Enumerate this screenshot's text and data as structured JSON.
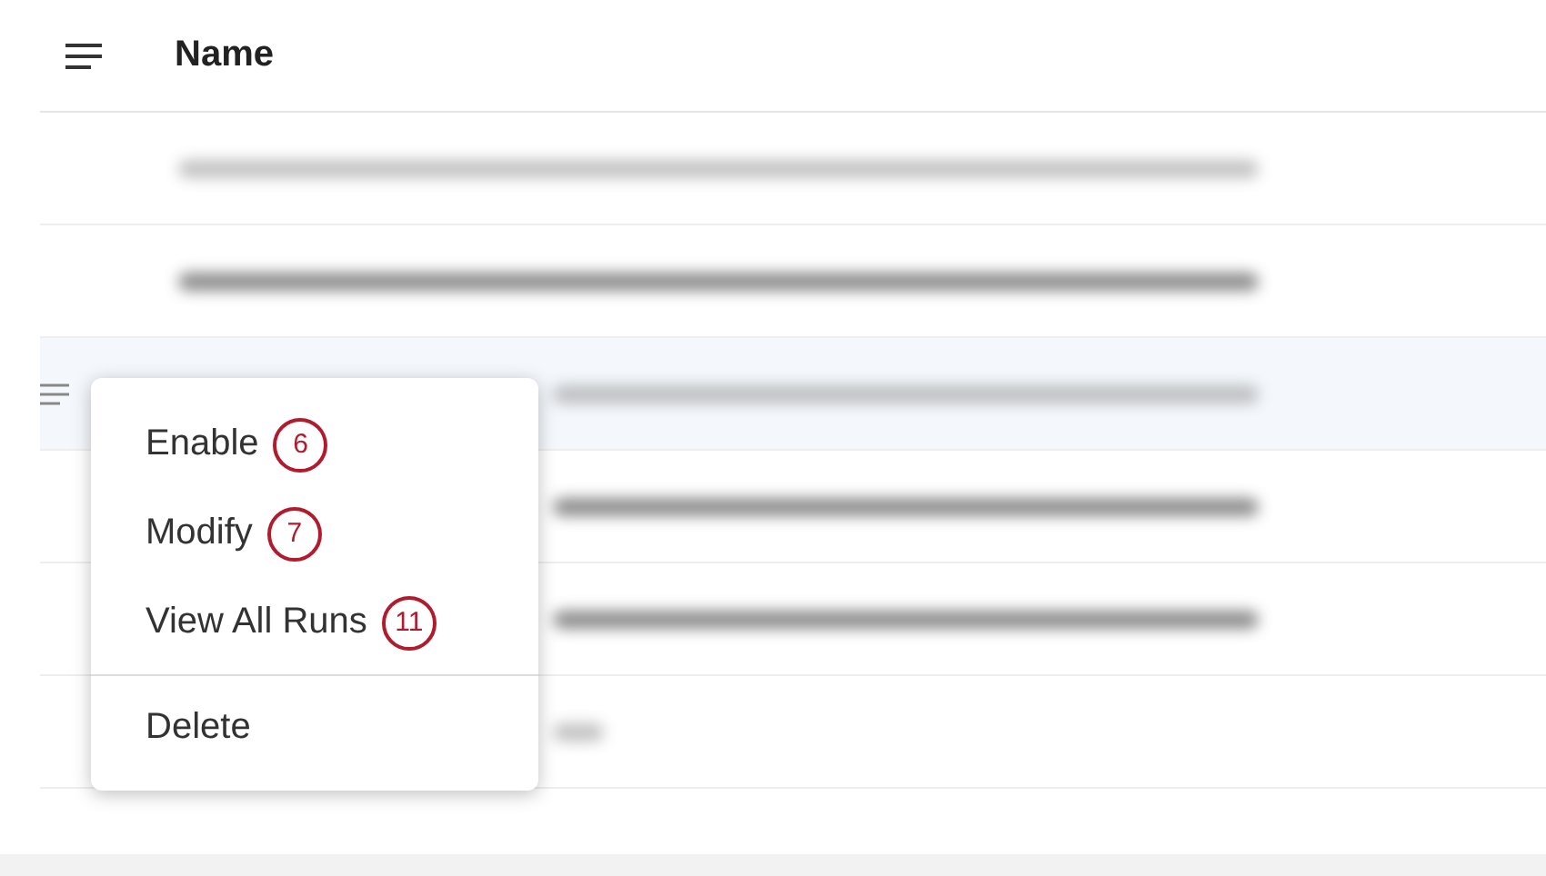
{
  "table": {
    "columns": [
      {
        "label": "Name"
      }
    ],
    "rows": [
      {
        "selected": false,
        "faded": true,
        "kind": "long"
      },
      {
        "selected": false,
        "faded": false,
        "kind": "long"
      },
      {
        "selected": true,
        "faded": true,
        "kind": "long"
      },
      {
        "selected": false,
        "faded": false,
        "kind": "long"
      },
      {
        "selected": false,
        "faded": false,
        "kind": "long"
      },
      {
        "selected": false,
        "faded": true,
        "kind": "short"
      }
    ]
  },
  "context_menu": {
    "items": [
      {
        "label": "Enable",
        "badge": "6",
        "divider_before": false
      },
      {
        "label": "Modify",
        "badge": "7",
        "divider_before": false
      },
      {
        "label": "View All Runs",
        "badge": "11",
        "divider_before": false
      },
      {
        "label": "Delete",
        "divider_before": true
      }
    ]
  }
}
